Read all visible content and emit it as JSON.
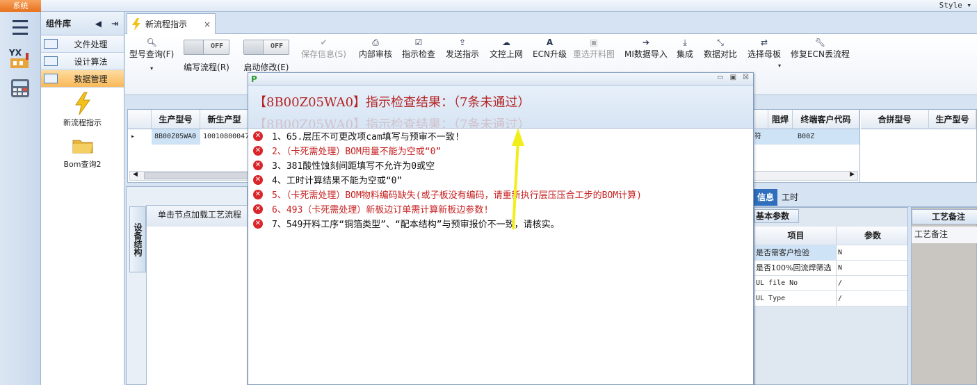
{
  "window": {
    "system_tab": "系统",
    "style_menu": "Style ▾"
  },
  "component_library": {
    "title": "组件库",
    "categories": [
      {
        "label": "文件处理"
      },
      {
        "label": "设计算法"
      },
      {
        "label": "数据管理",
        "active": true
      }
    ],
    "tools": [
      {
        "label": "新流程指示",
        "icon": "lightning-icon"
      },
      {
        "label": "Bom查询2",
        "icon": "folder-icon"
      }
    ]
  },
  "document_tab": {
    "label": "新流程指示",
    "close": "×"
  },
  "ribbon": {
    "query": {
      "label": "型号查询(F)",
      "icon": "search-icon"
    },
    "edit_flow": {
      "state": "OFF",
      "label": "编写流程(R)"
    },
    "start_modify": {
      "state": "OFF",
      "label": "启动修改(E)"
    },
    "save_info": {
      "label": "保存信息(S)",
      "icon": "check-icon",
      "disabled": true
    },
    "internal_review": {
      "label": "内部审核",
      "icon": "print-icon"
    },
    "instruction_check": {
      "label": "指示检查",
      "icon": "checkbox-icon"
    },
    "send_instruction": {
      "label": "发送指示",
      "icon": "upload-icon"
    },
    "doc_upload": {
      "label": "文控上网",
      "icon": "cloud-upload-icon"
    },
    "ecn_upgrade": {
      "label": "ECN升级",
      "icon": "font-icon"
    },
    "reselect_panel_chart": {
      "label": "重选开料图",
      "icon": "image-icon",
      "disabled": true
    },
    "mi_import": {
      "label": "MI数据导入",
      "icon": "sign-in-icon"
    },
    "integrate": {
      "label": "集成",
      "icon": "download-icon"
    },
    "data_compare": {
      "label": "数据对比",
      "icon": "compress-icon"
    },
    "select_mother_board": {
      "label": "选择母板",
      "icon": "shuffle-icon"
    },
    "repair_ecn_flow": {
      "label": "修复ECN丢流程",
      "icon": "wrench-icon"
    }
  },
  "grid": {
    "columns": [
      "生产型号",
      "新生产型"
    ],
    "row": {
      "prod_model": "8B00Z05WA0",
      "new_prod_model": "10010800047"
    },
    "right_columns": [
      "阻焊",
      "终端客户代码"
    ],
    "right_row": {
      "partial": "符",
      "customer_code": "B00Z"
    },
    "far_columns": [
      "合拼型号",
      "生产型号"
    ]
  },
  "lower_left": {
    "vertical_tab": "设备结构",
    "tree_header": "单击节点加载工艺流程"
  },
  "dialog": {
    "logo": "P",
    "title": "【8B00Z05WA0】指示检查结果：（7条未通过）",
    "ghost_title": "【8B00Z05WA0】指示检查结果：（7条未通过）",
    "messages": [
      {
        "text": "1、65.层压不可更改项cam填写与预审不一致!",
        "color": "black"
      },
      {
        "text": "2、（卡死需处理）BOM用量不能为空或“0”",
        "color": "red"
      },
      {
        "text": "3、381酸性蚀刻间距填写不允许为0或空",
        "color": "black"
      },
      {
        "text": "4、工时计算结果不能为空或“0”",
        "color": "black"
      },
      {
        "text": "5、（卡死需处理）BOM物料编码缺失(或子板没有编码，请重新执行层压压合工步的BOM计算)",
        "color": "red"
      },
      {
        "text": "6、493（卡死需处理）新板边订单需计算新板边参数!",
        "color": "red"
      },
      {
        "text": "7、549开料工序“铜箔类型”、“配本结构”与预审报价不一致，请核实。",
        "color": "black"
      }
    ]
  },
  "right_panel": {
    "tabs": {
      "info": "信息",
      "hours": "工时"
    },
    "basic_tab": "基本参数",
    "table_headers": [
      "项目",
      "参数"
    ],
    "params": [
      {
        "item": "是否需客户检验",
        "value": "N"
      },
      {
        "item": "是否100%回流焊筛选",
        "value": "N"
      },
      {
        "item": "UL file No",
        "value": "/"
      },
      {
        "item": "UL Type",
        "value": "/"
      }
    ],
    "notes_tab": "工艺备注",
    "notes_header": "工艺备注"
  },
  "colors": {
    "error_red": "#c62020",
    "accent_blue": "#2f6fbd",
    "annotation_arrow": "#f2ee1c"
  }
}
